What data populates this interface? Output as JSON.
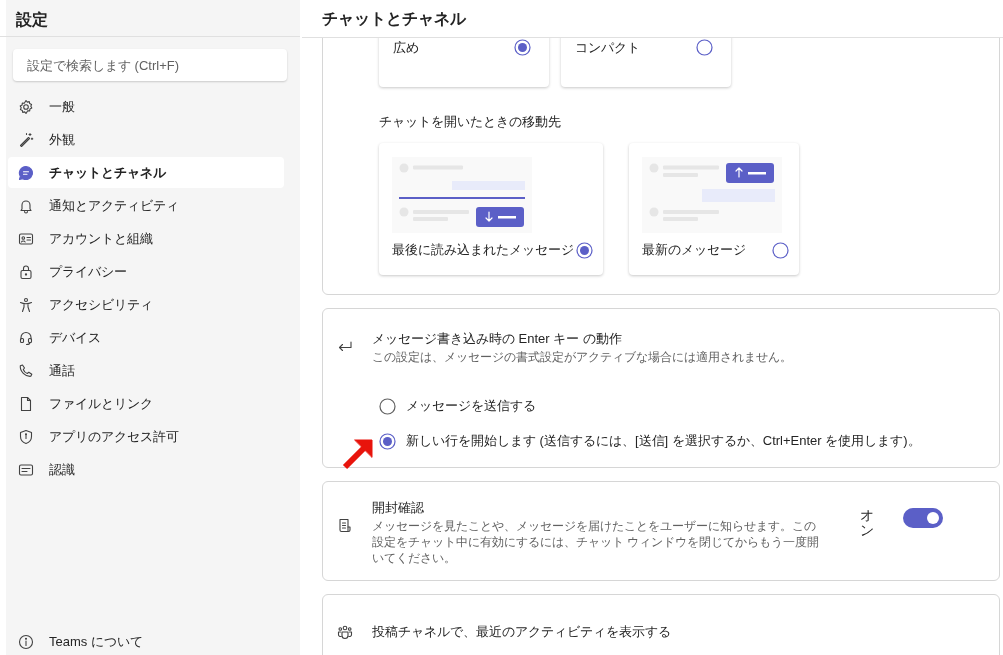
{
  "sidebar": {
    "title": "設定",
    "search": {
      "placeholder": "設定で検索します (Ctrl+F)"
    },
    "items": [
      {
        "label": "一般",
        "selected": false
      },
      {
        "label": "外観",
        "selected": false
      },
      {
        "label": "チャットとチャネル",
        "selected": true
      },
      {
        "label": "通知とアクティビティ",
        "selected": false
      },
      {
        "label": "アカウントと組織",
        "selected": false
      },
      {
        "label": "プライバシー",
        "selected": false
      },
      {
        "label": "アクセシビリティ",
        "selected": false
      },
      {
        "label": "デバイス",
        "selected": false
      },
      {
        "label": "通話",
        "selected": false
      },
      {
        "label": "ファイルとリンク",
        "selected": false
      },
      {
        "label": "アプリのアクセス許可",
        "selected": false
      },
      {
        "label": "認識",
        "selected": false
      }
    ],
    "footer": {
      "label": "Teams について"
    }
  },
  "header": {
    "title": "チャットとチャネル"
  },
  "density": {
    "options": [
      {
        "label": "広め",
        "selected": true
      },
      {
        "label": "コンパクト",
        "selected": false
      }
    ]
  },
  "open_chat": {
    "label": "チャットを開いたときの移動先",
    "options": [
      {
        "label": "最後に読み込まれたメッセージ",
        "kind": "last-read",
        "selected": true
      },
      {
        "label": "最新のメッセージ",
        "kind": "newest",
        "selected": false
      }
    ]
  },
  "enter_key": {
    "title": "メッセージ書き込み時の Enter キー の動作",
    "description": "この設定は、メッセージの書式設定がアクティブな場合には適用されません。",
    "options": [
      {
        "label": "メッセージを送信する",
        "selected": false
      },
      {
        "label": "新しい行を開始します (送信するには、[送信] を選択するか、Ctrl+Enter を使用します)。",
        "selected": true
      }
    ]
  },
  "read_receipts": {
    "title": "開封確認",
    "description": "メッセージを見たことや、メッセージを届けたことをユーザーに知らせます。この設定をチャット中に有効にするには、チャット ウィンドウを閉じてからもう一度開いてください。",
    "state_label": "オン",
    "on": true
  },
  "channel_activity": {
    "title": "投稿チャネルで、最近のアクティビティを表示する"
  }
}
